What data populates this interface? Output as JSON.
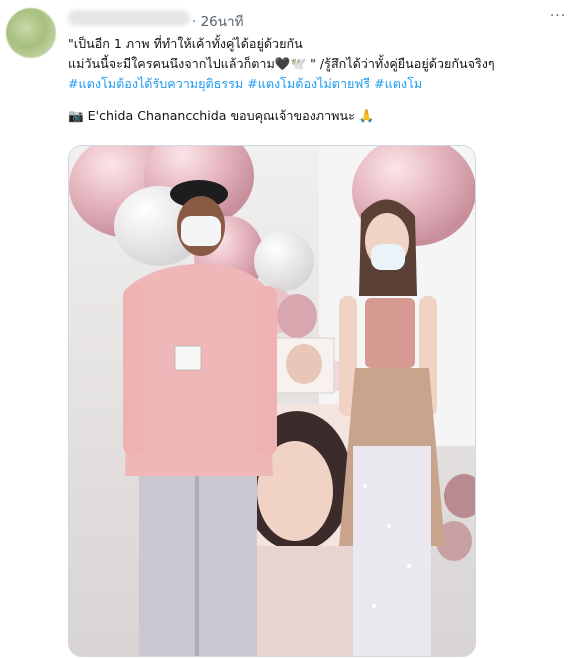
{
  "tweet": {
    "timestamp": "· 26นาที",
    "more_label": "···",
    "text_lines": [
      "\"เป็นอีก 1 ภาพ ที่ทำให้เค้าทั้งคู่ได้อยู่ด้วยกัน",
      "แม่วันนี้จะมีใครคนนึงจากไปแล้วก็ตาม🖤🕊️ \" /รู้สึกได้ว่าทั้งคู่ยืนอยู่ด้วยกันจริงๆ"
    ],
    "hashtags_line": [
      {
        "text": "#แตงโม",
        "tag": true
      },
      {
        "text": "ต้องได้รับความยุติธรรม ",
        "tag": true
      },
      {
        "text": "#แตงโม",
        "tag": true
      },
      {
        "text": "ต้องไม่ตายฟรี ",
        "tag": true
      },
      {
        "text": "#แตงโม",
        "tag": true
      }
    ],
    "credit_line": "📷 E'chida Chanancchida ขอบคุณเจ้าของภาพนะ 🙏"
  },
  "colors": {
    "link": "#1d9bf0",
    "secondary_text": "#536471",
    "border": "#cfd9de"
  },
  "photo": {
    "description_icon": "photo-of-two-people-with-balloons"
  }
}
